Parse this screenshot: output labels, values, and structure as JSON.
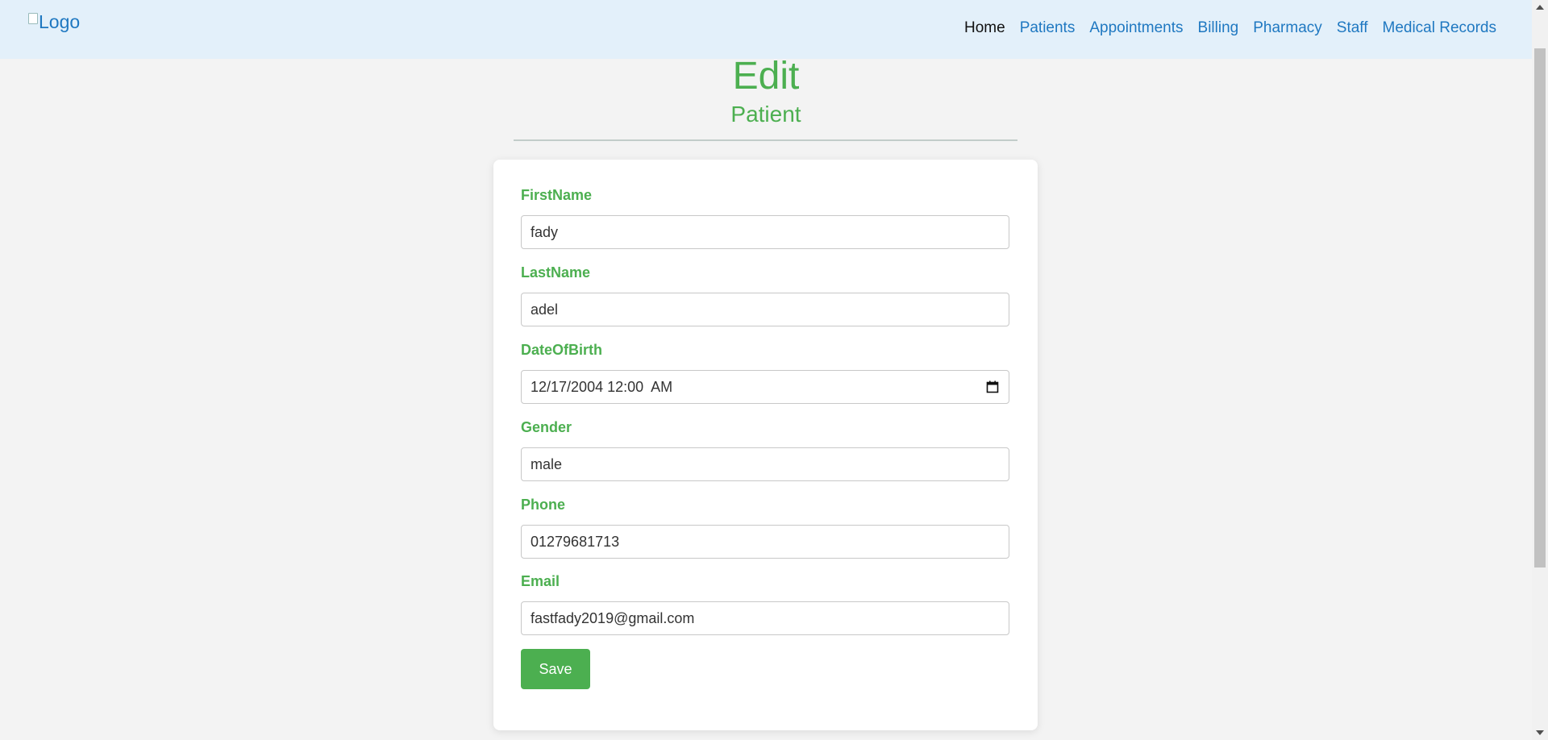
{
  "navbar": {
    "logo_alt": "Logo",
    "items": [
      {
        "label": "Home",
        "active": true
      },
      {
        "label": "Patients"
      },
      {
        "label": "Appointments"
      },
      {
        "label": "Billing"
      },
      {
        "label": "Pharmacy"
      },
      {
        "label": "Staff"
      },
      {
        "label": "Medical Records"
      }
    ]
  },
  "page": {
    "title": "Edit",
    "subtitle": "Patient"
  },
  "form": {
    "first_name": {
      "label": "FirstName",
      "value": "fady"
    },
    "last_name": {
      "label": "LastName",
      "value": "adel"
    },
    "date_of_birth": {
      "label": "DateOfBirth",
      "value": "12/17/2004 12:00  AM"
    },
    "gender": {
      "label": "Gender",
      "value": "male"
    },
    "phone": {
      "label": "Phone",
      "value": "01279681713"
    },
    "email": {
      "label": "Email",
      "value": "fastfady2019@gmail.com"
    },
    "save_label": "Save"
  },
  "colors": {
    "accent": "#4caf50",
    "link": "#1f78c1",
    "navbar_bg": "#e3f0fa",
    "page_bg": "#f3f3f3"
  }
}
